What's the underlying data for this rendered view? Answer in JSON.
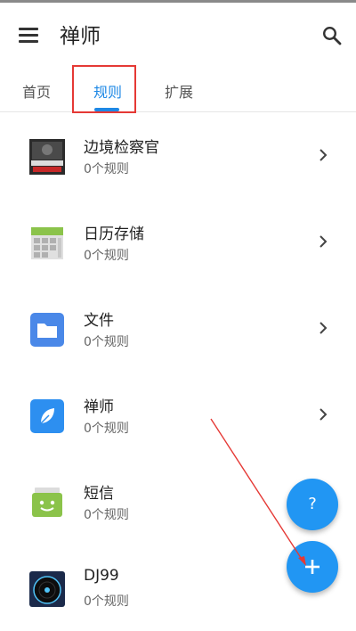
{
  "app": {
    "title": "禅师"
  },
  "tabs": [
    {
      "label": "首页"
    },
    {
      "label": "规则"
    },
    {
      "label": "扩展"
    }
  ],
  "active_tab": "规则",
  "apps": [
    {
      "name": "边境检察官",
      "rules": "0个规则",
      "icon": "game-thumbnail-icon"
    },
    {
      "name": "日历存储",
      "rules": "0个规则",
      "icon": "calendar-storage-icon"
    },
    {
      "name": "文件",
      "rules": "0个规则",
      "icon": "folder-icon"
    },
    {
      "name": "禅师",
      "rules": "0个规则",
      "icon": "leaf-icon"
    },
    {
      "name": "短信",
      "rules": "0个规则",
      "icon": "sms-icon"
    },
    {
      "name": "DJ99",
      "rules": "0个规则",
      "icon": "dj-disc-icon"
    }
  ],
  "fab": {
    "help_label": "?",
    "add_icon": "plus-icon"
  },
  "colors": {
    "accent": "#1e88e5",
    "fab": "#2196f3",
    "annotation": "#e53935"
  }
}
